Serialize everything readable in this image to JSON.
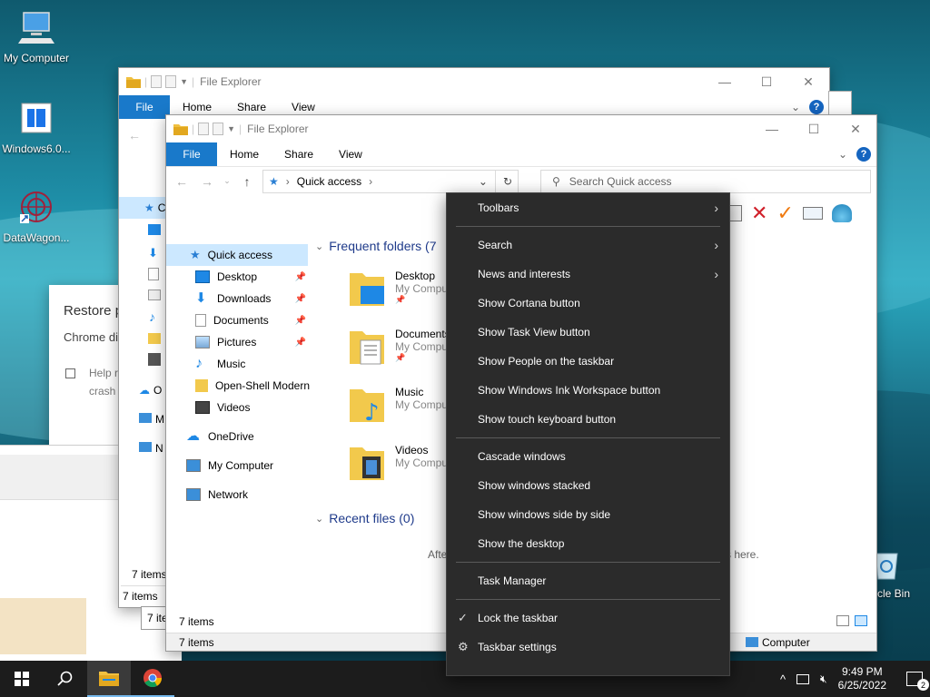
{
  "desktop": {
    "icons": [
      {
        "label": "My Computer",
        "icon": "computer-icon"
      },
      {
        "label": "Windows6.0...",
        "icon": "installer-icon"
      },
      {
        "label": "DataWagon...",
        "icon": "datawagon-icon"
      }
    ],
    "right_icon_label": "ycle Bin"
  },
  "chrome_dialog": {
    "title": "Restore p",
    "body": "Chrome di",
    "checkbox_text_1": "Help r",
    "checkbox_text_2": "crash"
  },
  "window_back": {
    "title": "File Explorer",
    "tabs": [
      "File",
      "Home",
      "Share",
      "View"
    ],
    "status": "7 items",
    "status_behind": "7 items",
    "status_behind2": "7 ite",
    "sidebar_cut": [
      "C",
      "O",
      "M",
      "N"
    ]
  },
  "window_front": {
    "title": "File Explorer",
    "tabs": [
      "File",
      "Home",
      "Share",
      "View"
    ],
    "address": "Quick access",
    "search_placeholder": "Search Quick access",
    "sidebar": {
      "quick_access": "Quick access",
      "pinned": [
        {
          "label": "Desktop",
          "icon": "desktop-icon",
          "pinned": true
        },
        {
          "label": "Downloads",
          "icon": "downloads-icon",
          "pinned": true
        },
        {
          "label": "Documents",
          "icon": "documents-icon",
          "pinned": true
        },
        {
          "label": "Pictures",
          "icon": "pictures-icon",
          "pinned": true
        },
        {
          "label": "Music",
          "icon": "music-icon",
          "pinned": false
        },
        {
          "label": "Open-Shell Modern",
          "icon": "folder-icon",
          "pinned": false
        },
        {
          "label": "Videos",
          "icon": "videos-icon",
          "pinned": false
        }
      ],
      "onedrive": "OneDrive",
      "my_computer": "My Computer",
      "network": "Network"
    },
    "frequent_header": "Frequent folders (7)",
    "frequent_header_shown": "Frequent folders (7",
    "folders": [
      {
        "name": "Desktop",
        "sub": "My Comput",
        "icon": "desktop-folder-icon"
      },
      {
        "name": "Documents",
        "sub": "My Comput",
        "icon": "documents-folder-icon"
      },
      {
        "name": "Music",
        "sub": "My Comput",
        "icon": "music-folder-icon"
      },
      {
        "name": "Videos",
        "sub": "My Comput",
        "icon": "videos-folder-icon"
      }
    ],
    "recent_header": "Recent files (0)",
    "recent_left": "Afte",
    "recent_right": "s here.",
    "status": "7 items",
    "status_right": "Computer",
    "status_bottom": "7 items"
  },
  "context_menu": {
    "items": [
      {
        "label": "Toolbars",
        "submenu": true
      },
      {
        "sep": true
      },
      {
        "label": "Search",
        "submenu": true
      },
      {
        "label": "News and interests",
        "submenu": true
      },
      {
        "label": "Show Cortana button"
      },
      {
        "label": "Show Task View button"
      },
      {
        "label": "Show People on the taskbar"
      },
      {
        "label": "Show Windows Ink Workspace button"
      },
      {
        "label": "Show touch keyboard button"
      },
      {
        "sep": true
      },
      {
        "label": "Cascade windows"
      },
      {
        "label": "Show windows stacked"
      },
      {
        "label": "Show windows side by side"
      },
      {
        "label": "Show the desktop"
      },
      {
        "sep": true
      },
      {
        "label": "Task Manager"
      },
      {
        "sep": true
      },
      {
        "label": "Lock the taskbar",
        "checked": true
      },
      {
        "label": "Taskbar settings",
        "gear": true
      }
    ]
  },
  "taskbar": {
    "time": "9:49 PM",
    "date": "6/25/2022",
    "notifications": "2"
  },
  "colors": {
    "accent": "#1979ca",
    "menu_bg": "#2b2b2b",
    "taskbar_bg": "#1c1c1c"
  }
}
